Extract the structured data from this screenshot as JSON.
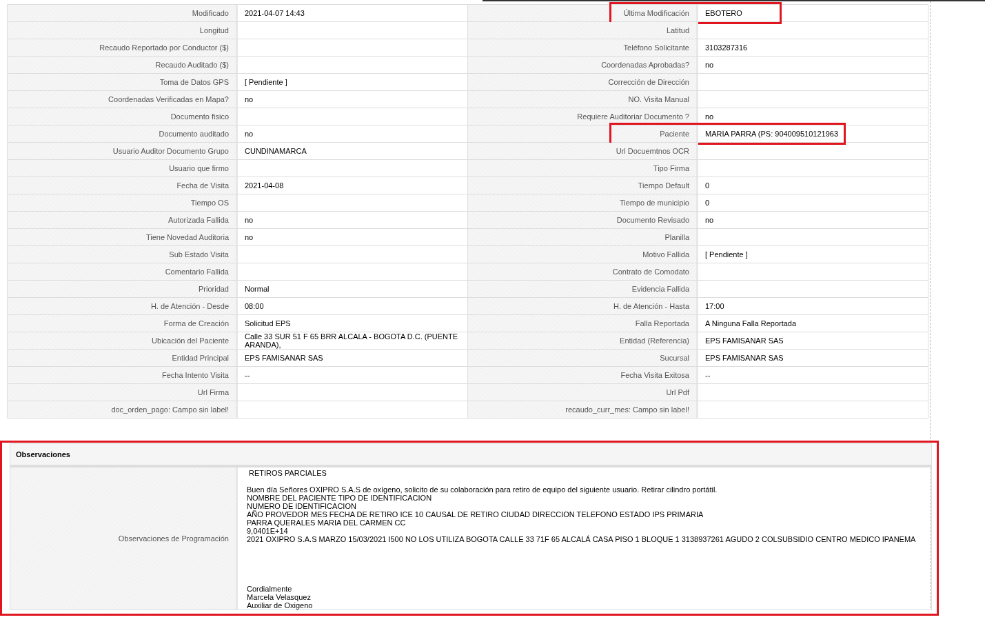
{
  "rows": [
    {
      "left": {
        "label": "Modificado",
        "value": "2021-04-07 14:43",
        "highlighted": false
      },
      "right": {
        "label": "Última Modificación",
        "value": "EBOTERO",
        "highlighted": true
      }
    },
    {
      "left": {
        "label": "Longitud",
        "highlighted": false
      },
      "right": {
        "label": "Latitud",
        "highlighted": false
      }
    },
    {
      "left": {
        "label": "Recaudo Reportado por Conductor ($)",
        "highlighted": false
      },
      "right": {
        "label": "Teléfono Solicitante",
        "value": "3103287316",
        "highlighted": false
      }
    },
    {
      "left": {
        "label": "Recaudo Auditado ($)",
        "highlighted": false
      },
      "right": {
        "label": "Coordenadas Aprobadas?",
        "value": "no",
        "highlighted": false
      }
    },
    {
      "left": {
        "label": "Toma de Datos GPS",
        "value": "[ Pendiente ]",
        "highlighted": false
      },
      "right": {
        "label": "Corrección de Dirección",
        "highlighted": false
      }
    },
    {
      "left": {
        "label": "Coordenadas Verificadas en Mapa?",
        "value": "no",
        "highlighted": false
      },
      "right": {
        "label": "NO. Visita Manual",
        "highlighted": false
      }
    },
    {
      "left": {
        "label": "Documento fisico",
        "highlighted": false
      },
      "right": {
        "label": "Requiere Auditoriar Documento ?",
        "value": "no",
        "highlighted": false
      }
    },
    {
      "left": {
        "label": "Documento auditado",
        "value": "no",
        "highlighted": false
      },
      "right": {
        "label": "Paciente",
        "value": "MARIA PARRA (PS: 904009510121963",
        "highlighted": true
      }
    },
    {
      "left": {
        "label": "Usuario Auditor Documento Grupo",
        "value": "CUNDINAMARCA",
        "highlighted": false
      },
      "right": {
        "label": "Url Docuemtnos OCR",
        "highlighted": false
      }
    },
    {
      "left": {
        "label": "Usuario que firmo",
        "highlighted": false
      },
      "right": {
        "label": "Tipo Firma",
        "highlighted": false
      }
    },
    {
      "left": {
        "label": "Fecha de Visita",
        "value": "2021-04-08",
        "highlighted": false
      },
      "right": {
        "label": "Tiempo Default",
        "value": "0",
        "highlighted": false
      }
    },
    {
      "left": {
        "label": "Tiempo OS",
        "highlighted": false
      },
      "right": {
        "label": "Tiempo de municipio",
        "value": "0",
        "highlighted": false
      }
    },
    {
      "left": {
        "label": "Autorizada Fallida",
        "value": "no",
        "highlighted": false
      },
      "right": {
        "label": "Documento Revisado",
        "value": "no",
        "highlighted": false
      }
    },
    {
      "left": {
        "label": "Tiene Novedad Auditoria",
        "value": "no",
        "highlighted": false
      },
      "right": {
        "label": "Planilla",
        "highlighted": false
      }
    },
    {
      "left": {
        "label": "Sub Estado Visita",
        "highlighted": false
      },
      "right": {
        "label": "Motivo Fallida",
        "value": "[ Pendiente ]",
        "highlighted": false
      }
    },
    {
      "left": {
        "label": "Comentario Fallida",
        "highlighted": false
      },
      "right": {
        "label": "Contrato de Comodato",
        "highlighted": false
      }
    },
    {
      "left": {
        "label": "Prioridad",
        "value": "Normal",
        "highlighted": false
      },
      "right": {
        "label": "Evidencia Fallida",
        "highlighted": false
      }
    },
    {
      "left": {
        "label": "H. de Atención - Desde",
        "value": "08:00",
        "highlighted": false
      },
      "right": {
        "label": "H. de Atención - Hasta",
        "value": "17:00",
        "highlighted": false
      }
    },
    {
      "left": {
        "label": "Forma de Creación",
        "value": "Solicitud EPS",
        "highlighted": false
      },
      "right": {
        "label": "Falla Reportada",
        "value": "A Ninguna Falla Reportada",
        "highlighted": false
      }
    },
    {
      "left": {
        "label": "Ubicación del Paciente",
        "value": "Calle 33 SUR 51 F 65 BRR ALCALA - BOGOTA D.C. (PUENTE ARANDA),",
        "highlighted": false
      },
      "right": {
        "label": "Entidad (Referencia)",
        "value": "EPS FAMISANAR SAS",
        "highlighted": false
      }
    },
    {
      "left": {
        "label": "Entidad Principal",
        "value": "EPS FAMISANAR SAS",
        "highlighted": false
      },
      "right": {
        "label": "Sucursal",
        "value": "EPS FAMISANAR SAS",
        "highlighted": false
      }
    },
    {
      "left": {
        "label": "Fecha Intento Visita",
        "value": "--",
        "highlighted": false
      },
      "right": {
        "label": "Fecha Visita Exitosa",
        "value": "--",
        "highlighted": false
      }
    },
    {
      "left": {
        "label": "Url Firma",
        "highlighted": false
      },
      "right": {
        "label": "Url Pdf",
        "highlighted": false
      }
    },
    {
      "left": {
        "label": "doc_orden_pago: Campo sin label!",
        "highlighted": false
      },
      "right": {
        "label": "recaudo_curr_mes: Campo sin label!",
        "highlighted": false
      }
    }
  ],
  "observations": {
    "title": "Observaciones",
    "highlighted": true,
    "label": "Observaciones de Programación",
    "heading": "RETIROS PARCIALES",
    "lines": [
      "Buen día Señores OXIPRO S.A.S de oxígeno, solicito de su colaboración para retiro de equipo del siguiente usuario. Retirar cilindro portátil.",
      "NOMBRE DEL PACIENTE TIPO DE IDENTIFICACION",
      "NUMERO DE IDENTIFICACION",
      "AÑO PROVEDOR MES FECHA DE RETIRO ICE 10 CAUSAL DE RETIRO CIUDAD DIRECCION TELEFONO ESTADO IPS PRIMARIA",
      "PARRA QUERALES MARIA DEL CARMEN CC",
      "9,0401E+14",
      "2021 OXIPRO S.A.S MARZO 15/03/2021 I500 NO LOS UTILIZA BOGOTA CALLE 33 71F 65 ALCALÁ CASA PISO 1 BLOQUE 1 3138937261 AGUDO 2 COLSUBSIDIO CENTRO MEDICO IPANEMA"
    ],
    "signature": [
      "Cordialmente",
      "Marcela Velasquez",
      "Auxiliar de Oxigeno"
    ]
  }
}
